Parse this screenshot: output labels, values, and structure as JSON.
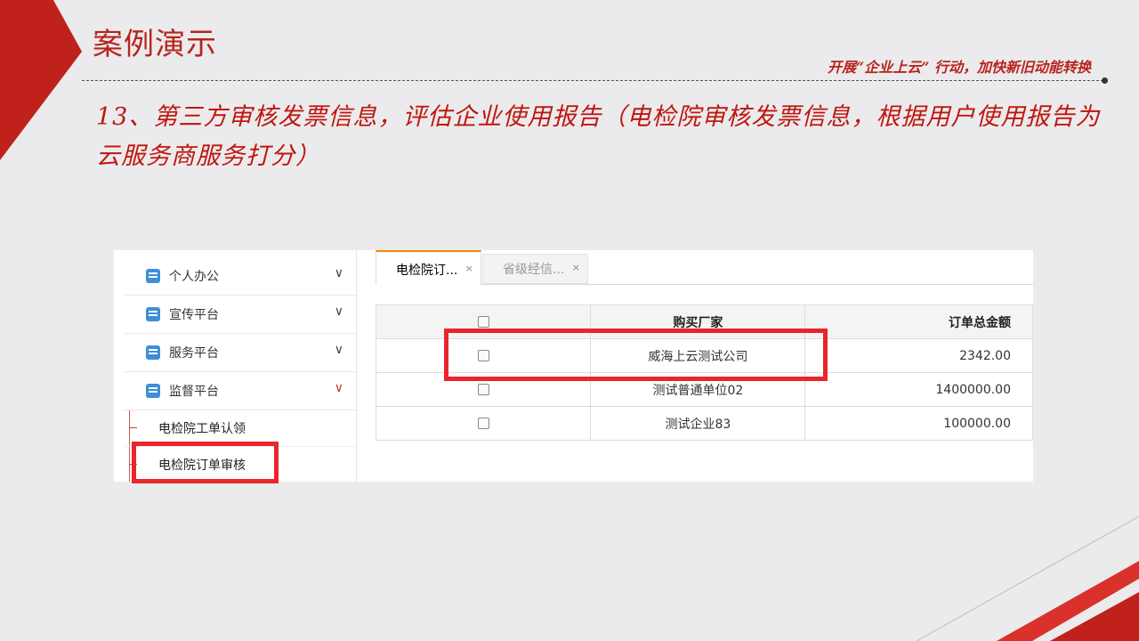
{
  "slide": {
    "title": "案例演示",
    "slogan": "开展“企业上云” 行动，加快新旧动能转换",
    "step_text": "13、第三方审核发票信息，评估企业使用报告（电检院审核发票信息，根据用户使用报告为云服务商服务打分）"
  },
  "sidebar": {
    "items": [
      {
        "label": "个人办公",
        "icon": "document-icon",
        "expanded": false
      },
      {
        "label": "宣传平台",
        "icon": "document-icon",
        "expanded": false
      },
      {
        "label": "服务平台",
        "icon": "document-icon",
        "expanded": false
      },
      {
        "label": "监督平台",
        "icon": "document-icon",
        "expanded": true
      }
    ],
    "sub_items": [
      {
        "label": "电检院工单认领"
      },
      {
        "label": "电检院订单审核"
      }
    ]
  },
  "tabs": [
    {
      "label": "电检院订...",
      "close": "×",
      "active": true
    },
    {
      "label": "省级经信...",
      "close": "×",
      "active": false
    }
  ],
  "table": {
    "columns": [
      "",
      "购买厂家",
      "订单总金额"
    ],
    "rows": [
      {
        "buyer": "威海上云测试公司",
        "amount": "2342.00"
      },
      {
        "buyer": "测试普通单位02",
        "amount": "1400000.00"
      },
      {
        "buyer": "测试企业83",
        "amount": "100000.00"
      }
    ]
  },
  "colors": {
    "accent_red": "#b8241c",
    "highlight_red": "#e8262c",
    "tab_active_orange": "#f08a00",
    "menu_icon_blue": "#3d8fd8"
  }
}
